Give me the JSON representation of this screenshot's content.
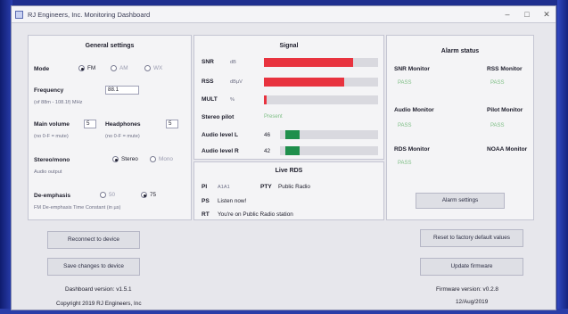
{
  "window": {
    "title": "RJ Engineers, Inc. Monitoring Dashboard"
  },
  "general": {
    "title": "General settings",
    "mode_label": "Mode",
    "mode_options": [
      "FM",
      "AM",
      "WX"
    ],
    "frequency_label": "Frequency",
    "frequency_value": "88.1",
    "frequency_hint": "(of 88m - 108.1f) MHz",
    "main_volume_label": "Main volume",
    "main_volume_value": "5",
    "main_volume_hint": "(no 0-F = mute)",
    "headphones_label": "Headphones",
    "headphones_value": "5",
    "headphones_hint": "(no 0-F = mute)",
    "stereo_label": "Stereo/mono",
    "stereo_options": [
      "Stereo",
      "Mono"
    ],
    "stereo_hint": "Audio output",
    "deemph_label": "De-emphasis",
    "deemph_options": [
      "50",
      "75"
    ],
    "deemph_hint": "FM De-emphasis Time Constant (in µs)"
  },
  "signal": {
    "title": "Signal",
    "snr_label": "SNR",
    "snr_unit": "dB",
    "snr_fill": 0.78,
    "rss_label": "RSS",
    "rss_unit": "dBµV",
    "rss_fill": 0.7,
    "mult_label": "MULT",
    "mult_unit": "%",
    "mult_fill": 0.02,
    "pilot_label": "Stereo pilot",
    "pilot_value": "Present",
    "audio_l_label": "Audio level L",
    "audio_l_value": "46",
    "audio_r_label": "Audio level R",
    "audio_r_value": "42",
    "colors": {
      "red": "#e8333f",
      "green": "#1f8f4c"
    }
  },
  "rds": {
    "title": "Live RDS",
    "pi_label": "PI",
    "pi_value": "A1A1",
    "pty_label": "PTY",
    "pty_value": "Public Radio",
    "ps_label": "PS",
    "ps_value": "Listen now!",
    "rt_label": "RT",
    "rt_value": "You're on Public Radio station"
  },
  "alarm": {
    "title": "Alarm status",
    "snr_monitor": "SNR Monitor",
    "snr_status": "PASS",
    "rss_monitor": "RSS Monitor",
    "rss_status": "PASS",
    "audio_monitor": "Audio Monitor",
    "audio_status": "PASS",
    "pilot_monitor": "Pilot Monitor",
    "pilot_status": "PASS",
    "rds_monitor": "RDS Monitor",
    "rds_status": "PASS",
    "noaa_monitor": "NOAA Monitor",
    "alarm_settings": "Alarm settings"
  },
  "footer": {
    "reconnect": "Reconnect to device",
    "save": "Save changes to device",
    "dashboard_version": "Dashboard version: v1.5.1",
    "copyright": "Copyright 2019 RJ Engineers, Inc",
    "reset": "Reset to factory default values",
    "update": "Update firmware",
    "firmware_version": "Firmware version: v0.2.8",
    "firmware_date": "12/Aug/2019"
  }
}
